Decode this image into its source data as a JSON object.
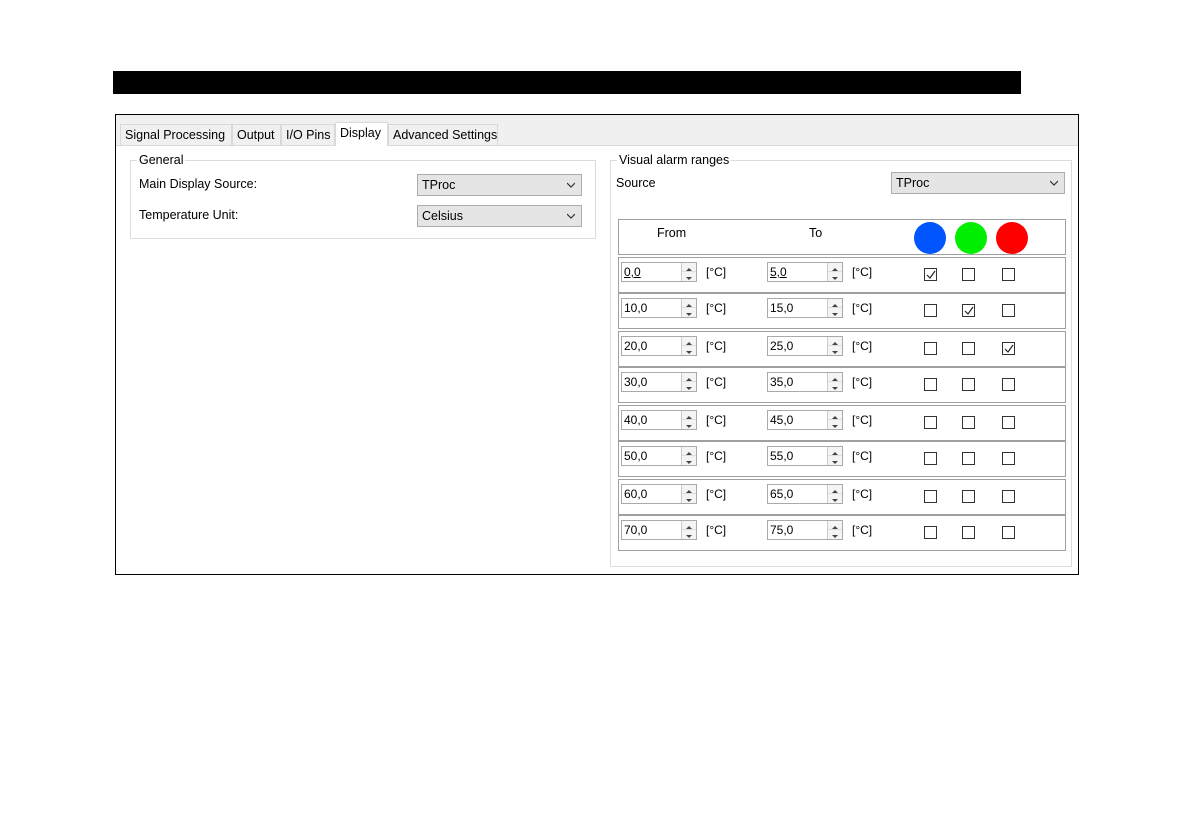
{
  "tabs": [
    {
      "label": "Signal Processing",
      "active": false
    },
    {
      "label": "Output",
      "active": false
    },
    {
      "label": "I/O Pins",
      "active": false
    },
    {
      "label": "Display",
      "active": true
    },
    {
      "label": "Advanced Settings",
      "active": false
    }
  ],
  "general": {
    "title": "General",
    "main_display_source_label": "Main Display Source:",
    "main_display_source_value": "TProc",
    "temperature_unit_label": "Temperature Unit:",
    "temperature_unit_value": "Celsius"
  },
  "alarm": {
    "title": "Visual alarm ranges",
    "source_label": "Source",
    "source_value": "TProc",
    "header": {
      "from": "From",
      "to": "To"
    },
    "colors": [
      "#0055ff",
      "#00ee00",
      "#ff0000"
    ],
    "unit": "[°C]",
    "rows": [
      {
        "from": "0,0",
        "to": "5,0",
        "checks": [
          true,
          false,
          false
        ]
      },
      {
        "from": "10,0",
        "to": "15,0",
        "checks": [
          false,
          true,
          false
        ]
      },
      {
        "from": "20,0",
        "to": "25,0",
        "checks": [
          false,
          false,
          true
        ]
      },
      {
        "from": "30,0",
        "to": "35,0",
        "checks": [
          false,
          false,
          false
        ]
      },
      {
        "from": "40,0",
        "to": "45,0",
        "checks": [
          false,
          false,
          false
        ]
      },
      {
        "from": "50,0",
        "to": "55,0",
        "checks": [
          false,
          false,
          false
        ]
      },
      {
        "from": "60,0",
        "to": "65,0",
        "checks": [
          false,
          false,
          false
        ]
      },
      {
        "from": "70,0",
        "to": "75,0",
        "checks": [
          false,
          false,
          false
        ]
      }
    ]
  }
}
